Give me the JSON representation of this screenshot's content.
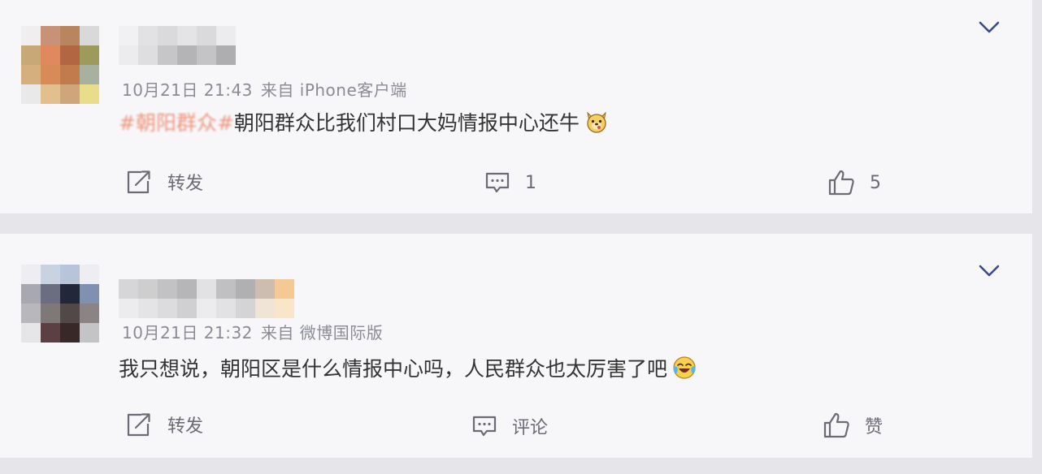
{
  "comments": [
    {
      "timestamp": "10月21日 21:43",
      "source": "来自 iPhone客户端",
      "hashtag": "#朝阳群众#",
      "text": "朝阳群众比我们村口大妈情报中心还牛",
      "emoji": "doge-icon",
      "repost_label": "转发",
      "comment_count": "1",
      "like_count": "5"
    },
    {
      "timestamp": "10月21日 21:32",
      "source": "来自 微博国际版",
      "text": "我只想说，朝阳区是什么情报中心吗，人民群众也太厉害了吧",
      "emoji": "laugh-cry-icon",
      "repost_label": "转发",
      "comment_label": "评论",
      "like_label": "赞"
    }
  ],
  "colors": {
    "background": "#e6e6ea",
    "card": "#f7f7fa",
    "body_text": "#333333",
    "meta_text": "#8b8b96",
    "topic": "#eb7350",
    "icon": "#6b6b76"
  }
}
